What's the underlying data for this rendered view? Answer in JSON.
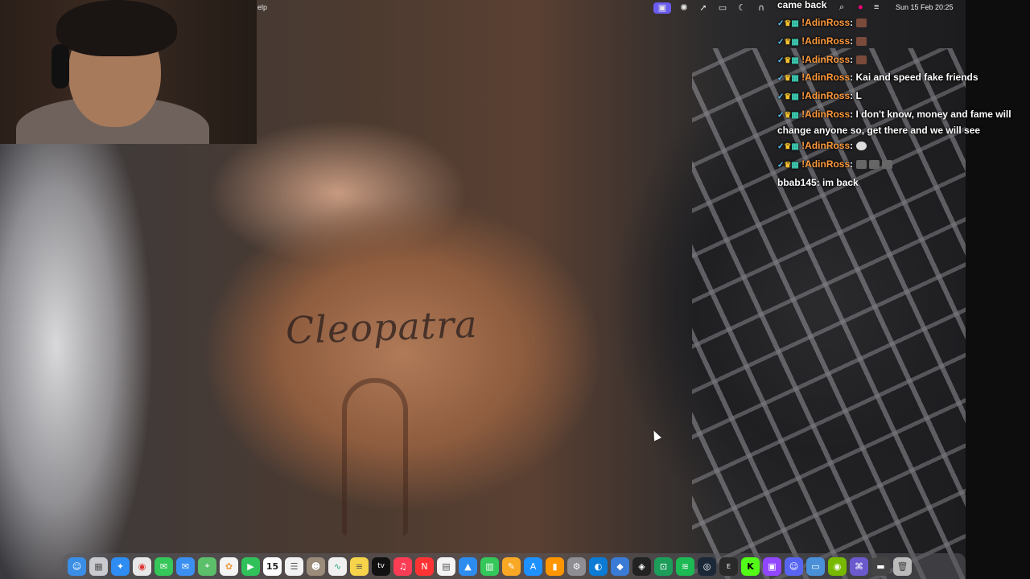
{
  "menubar": {
    "help_fragment": "elp",
    "clock": "Sun 15 Feb  20:25",
    "status_icons": [
      "screen-record-icon",
      "sparkle-icon",
      "rocket-icon",
      "display-icon",
      "moon-icon",
      "headphones-icon",
      "control-center-icon",
      "search-icon",
      "siri-icon",
      "notification-icon"
    ]
  },
  "chat": {
    "header": "came back",
    "messages": [
      {
        "user": "!AdinRoss",
        "text": ""
      },
      {
        "user": "!AdinRoss",
        "text": ""
      },
      {
        "user": "!AdinRoss",
        "text": ""
      },
      {
        "user": "!AdinRoss",
        "text": "Kai and speed fake friends"
      },
      {
        "user": "!AdinRoss",
        "text": "L"
      },
      {
        "user": "!AdinRoss",
        "text": "I don't know, money and fame will change anyone so, get there and we will see"
      },
      {
        "user": "!AdinRoss",
        "text": ""
      },
      {
        "user": "!AdinRoss",
        "text": ""
      },
      {
        "user": "bbab145",
        "text": "im back"
      }
    ]
  },
  "video": {
    "tattoo_text": "Cleopatra"
  },
  "dock": {
    "calendar_day": "15",
    "tv_label": "tv",
    "items": [
      "finder",
      "launchpad",
      "safari",
      "chrome",
      "messages",
      "mail",
      "maps",
      "photos",
      "facetime",
      "calendar",
      "reminders",
      "contacts",
      "freeform",
      "notes",
      "tv",
      "music",
      "news",
      "numbers-sheet",
      "keynote",
      "numbers",
      "pages",
      "app-store",
      "books",
      "settings",
      "edge",
      "files",
      "roblox",
      "discord-bot",
      "spotify",
      "steam",
      "epic",
      "kick",
      "twitch",
      "discord",
      "finder-2",
      "nvidia",
      "vs",
      "folder",
      "trash"
    ]
  }
}
